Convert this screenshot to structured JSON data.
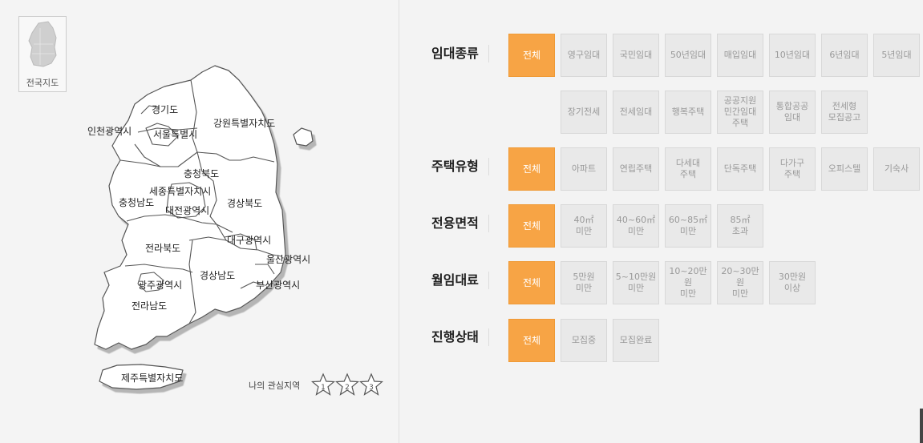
{
  "map": {
    "national_label": "전국지도",
    "regions": {
      "gyeonggi": "경기도",
      "incheon": "인천광역시",
      "seoul": "서울특별시",
      "gangwon": "강원특별자치도",
      "chungbuk": "충청북도",
      "sejong": "세종특별자치시",
      "chungnam": "충청남도",
      "daejeon": "대전광역시",
      "gyeongbuk": "경상북도",
      "daegu": "대구광역시",
      "jeonbuk": "전라북도",
      "ulsan": "울산광역시",
      "gwangju": "광주광역시",
      "gyeongnam": "경상남도",
      "busan": "부산광역시",
      "jeonnam": "전라남도",
      "jeju": "제주특별자치도"
    },
    "favorites_label": "나의 관심지역",
    "stars": [
      "1",
      "2",
      "3"
    ]
  },
  "filters": {
    "rental_type": {
      "label": "임대종류",
      "options": [
        "전체",
        "영구임대",
        "국민임대",
        "50년임대",
        "매입임대",
        "10년임대",
        "6년임대",
        "5년임대",
        "장기전세",
        "전세임대",
        "행복주택",
        "공공지원\n민간임대\n주택",
        "통합공공\n임대",
        "전세형\n모집공고"
      ]
    },
    "housing_type": {
      "label": "주택유형",
      "options": [
        "전체",
        "아파트",
        "연립주택",
        "다세대\n주택",
        "단독주택",
        "다가구\n주택",
        "오피스텔",
        "기숙사"
      ]
    },
    "area": {
      "label": "전용면적",
      "options": [
        "전체",
        "40㎡\n미만",
        "40~60㎡\n미만",
        "60~85㎡\n미만",
        "85㎡\n초과"
      ]
    },
    "rent": {
      "label": "월임대료",
      "options": [
        "전체",
        "5만원\n미만",
        "5~10만원\n미만",
        "10~20만원\n미만",
        "20~30만원\n미만",
        "30만원\n이상"
      ]
    },
    "status": {
      "label": "진행상태",
      "options": [
        "전체",
        "모집중",
        "모집완료"
      ]
    }
  },
  "colors": {
    "selected": "#f7a445",
    "option_bg": "#e9e9e9"
  }
}
